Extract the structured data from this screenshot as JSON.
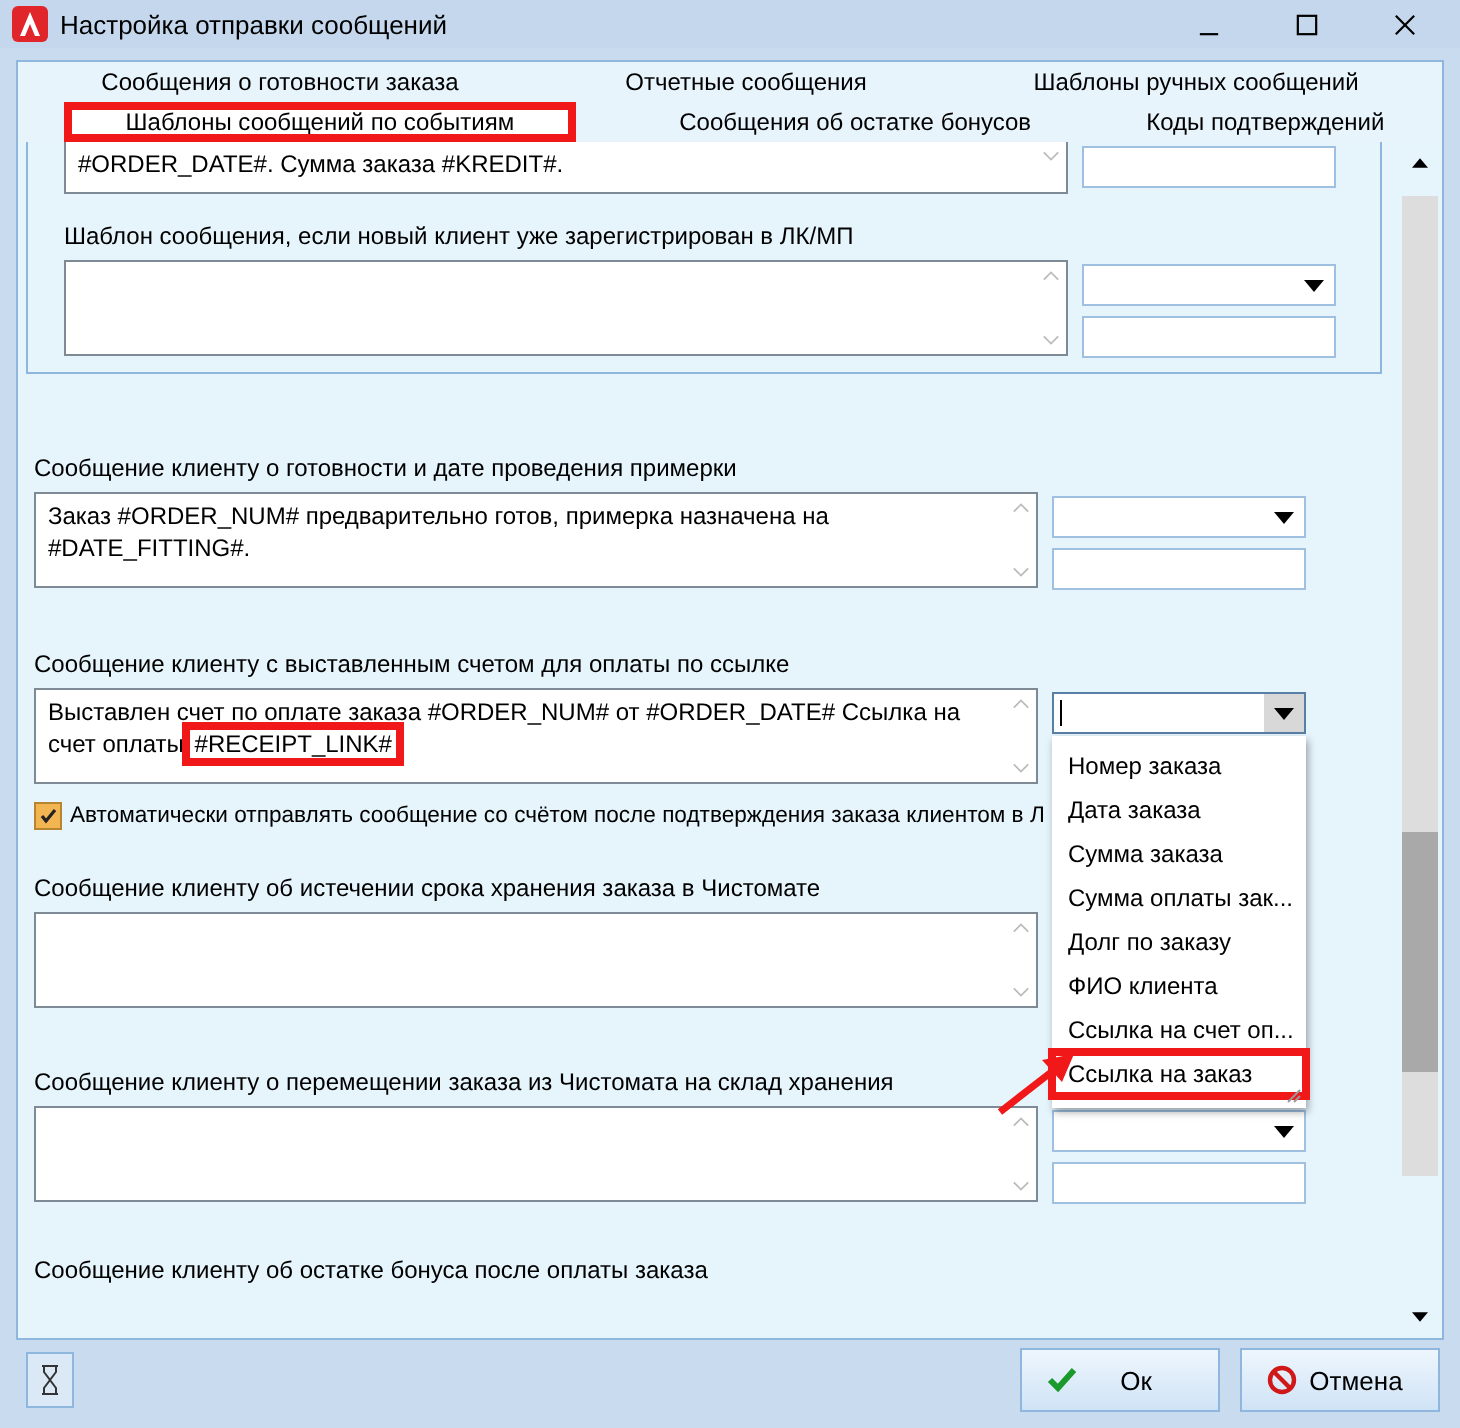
{
  "window": {
    "title": "Настройка отправки сообщений"
  },
  "tab_rows": [
    [
      {
        "label": "Сообщения о готовности заказа",
        "selected": false,
        "highlighted": false
      },
      {
        "label": "Отчетные сообщения",
        "selected": false,
        "highlighted": false
      },
      {
        "label": "Шаблоны ручных сообщений",
        "selected": false,
        "highlighted": false
      }
    ],
    [
      {
        "label": "Шаблоны сообщений по событиям",
        "selected": true,
        "highlighted": true
      },
      {
        "label": "Сообщения об остатке бонусов",
        "selected": false,
        "highlighted": false
      },
      {
        "label": "Коды подтверждений",
        "selected": false,
        "highlighted": false
      }
    ]
  ],
  "group": {
    "sections": [
      {
        "value_parts": [
          {
            "text": "#ORDER_DATE#. Сумма заказа #KREDIT#.",
            "highlighted": false
          }
        ],
        "controls": [
          {
            "kind": "field"
          }
        ]
      },
      {
        "label": "Шаблон сообщения, если новый клиент уже зарегистрирован в ЛК/МП",
        "controls": [
          {
            "kind": "combo",
            "open": false
          },
          {
            "kind": "field"
          }
        ]
      }
    ]
  },
  "sections": [
    {
      "label": "Сообщение клиенту о готовности и дате проведения примерки",
      "value_parts": [
        {
          "text": "Заказ #ORDER_NUM# предварительно готов, примерка назначена на #DATE_FITTING#.",
          "highlighted": false
        }
      ],
      "controls": [
        {
          "kind": "combo",
          "open": false
        },
        {
          "kind": "field"
        }
      ]
    },
    {
      "label": "Сообщение клиенту с выставленным счетом для оплаты по ссылке",
      "value_parts": [
        {
          "text": "Выставлен счет по оплате заказа #ORDER_NUM# от #ORDER_DATE# Ссылка на счет оплаты ",
          "highlighted": false
        },
        {
          "text": "#RECEIPT_LINK#",
          "highlighted": true
        }
      ],
      "controls": [
        {
          "kind": "combo",
          "open": true
        }
      ],
      "checkbox": {
        "label": "Автоматически отправлять сообщение со счётом после подтверждения заказа клиентом в Л",
        "checked": true
      }
    },
    {
      "label": "Сообщение клиенту об истечении срока хранения заказа в Чистомате"
    },
    {
      "label": "Сообщение клиенту о перемещении заказа из Чистомата на склад хранения",
      "controls": [
        {
          "kind": "combo",
          "open": false
        },
        {
          "kind": "field"
        }
      ],
      "arrow": true
    },
    {
      "label": "Сообщение клиенту об остатке бонуса после оплаты заказа"
    }
  ],
  "dropdown": {
    "items": [
      {
        "label": "Номер заказа",
        "highlighted": false
      },
      {
        "label": "Дата заказа",
        "highlighted": false
      },
      {
        "label": "Сумма заказа",
        "highlighted": false
      },
      {
        "label": "Сумма оплаты зак...",
        "highlighted": false
      },
      {
        "label": "Долг по заказу",
        "highlighted": false
      },
      {
        "label": "ФИО клиента",
        "highlighted": false
      },
      {
        "label": "Ссылка на счет оп...",
        "highlighted": false
      },
      {
        "label": "Ссылка на заказ",
        "highlighted": true
      }
    ]
  },
  "buttons": [
    {
      "label": "Ок",
      "kind": "ok"
    },
    {
      "label": "Отмена",
      "kind": "cancel"
    }
  ]
}
